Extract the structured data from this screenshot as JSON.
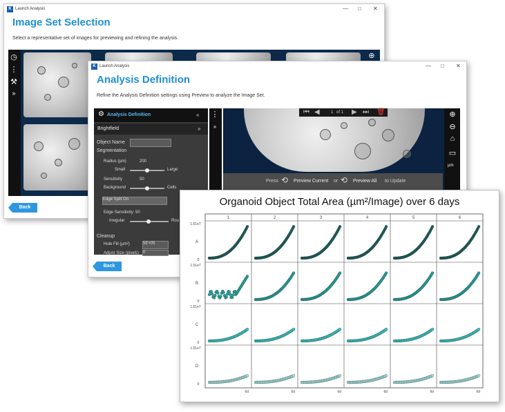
{
  "image_set_window": {
    "app_title": "Launch Analysis",
    "heading": "Image Set Selection",
    "subtitle": "Select a representative set of images for previewing and refining the analysis.",
    "back_label": "Back",
    "window_controls": {
      "minimize": "—",
      "maximize": "□",
      "close": "✕"
    }
  },
  "definition_window": {
    "app_title": "Launch Analysis",
    "heading": "Analysis Definition",
    "subtitle": "Refine the Analysis Definition settings using Preview to analyze the Image Set.",
    "back_label": "Back",
    "window_controls": {
      "minimize": "—",
      "maximize": "□",
      "close": "✕"
    },
    "panel": {
      "title": "Analysis Definition",
      "collapse_glyph": "«",
      "section": "Brightfield",
      "section_glyph": "»",
      "object_name_label": "Object Name",
      "object_name_value": "",
      "segmentation_label": "Segmentation",
      "radius_label": "Radius (µm)",
      "radius_value": "200",
      "small_label": "Small",
      "large_label": "Large",
      "sensitivity_label": "Sensitivity",
      "sensitivity_value": "50",
      "background_label": "Background",
      "cells_label": "Cells",
      "edge_split_label": "Edge Split On",
      "edge_sensitivity_label": "Edge Sensitivity: 50",
      "irregular_label": "Irregular",
      "round_label": "Rou",
      "cleanup_label": "Cleanup",
      "hole_fill_label": "Hole Fill (µm²)",
      "hole_fill_value": "5E+05",
      "adjust_size_label": "Adjust Size (pixels)",
      "adjust_size_value": "0"
    },
    "viewer": {
      "page_current": "1",
      "page_of": "of 1",
      "update_prefix": "Press",
      "preview_current": "Preview Current",
      "or_text": "or",
      "preview_all": "Preview All",
      "update_suffix": "to Update",
      "unit_label": "µm"
    }
  },
  "chart_panel": {
    "chart_data": {
      "type": "line",
      "title": "Organoid Object Total Area (µm²/Image) over 6 days",
      "columns": [
        "1",
        "2",
        "3",
        "4",
        "5",
        "6"
      ],
      "rows": [
        "A",
        "B",
        "C",
        "D"
      ],
      "y_top_label": "1.51e7",
      "y_bottom_label": "0",
      "x_end_label": "6d",
      "row_colors": {
        "A": "#1f5a57",
        "B": "#2a9d98",
        "C": "#3fc4be",
        "D": "#a8e0dc"
      },
      "row_final_fraction": {
        "A": 0.95,
        "B": 0.8,
        "C": 0.35,
        "D": 0.2
      },
      "row_B_col1_note": "noisy early growth"
    }
  }
}
